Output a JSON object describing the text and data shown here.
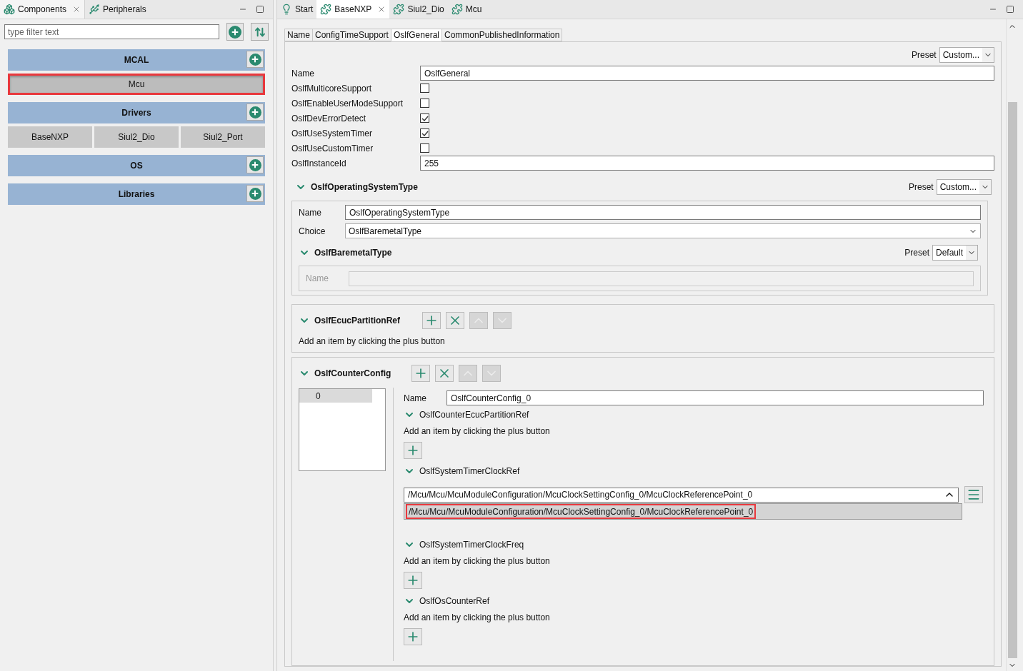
{
  "left_panel": {
    "tabs": [
      {
        "label": "Components",
        "kind": "components",
        "selected": true,
        "closable": true
      },
      {
        "label": "Peripherals",
        "kind": "peripherals",
        "selected": false,
        "closable": false
      }
    ],
    "filter": {
      "placeholder": "type filter text"
    },
    "categories": [
      {
        "name": "MCAL",
        "items": [
          {
            "label": "Mcu",
            "selected": true,
            "highlighted": true
          }
        ]
      },
      {
        "name": "Drivers",
        "items": [
          {
            "label": "BaseNXP",
            "selected": false,
            "highlighted": false
          },
          {
            "label": "Siul2_Dio",
            "selected": false,
            "highlighted": false
          },
          {
            "label": "Siul2_Port",
            "selected": false,
            "highlighted": false
          }
        ]
      },
      {
        "name": "OS"
      },
      {
        "name": "Libraries"
      }
    ]
  },
  "editor": {
    "tabs": [
      {
        "label": "Start",
        "kind": "start",
        "selected": false,
        "closable": false
      },
      {
        "label": "BaseNXP",
        "kind": "module",
        "selected": true,
        "closable": true
      },
      {
        "label": "Siul2_Dio",
        "kind": "module",
        "selected": false,
        "closable": false
      },
      {
        "label": "Mcu",
        "kind": "module",
        "selected": false,
        "closable": false
      }
    ],
    "subtabs": [
      {
        "label": "Name",
        "selected": false
      },
      {
        "label": "ConfigTimeSupport",
        "selected": false
      },
      {
        "label": "OslfGeneral",
        "selected": true
      },
      {
        "label": "CommonPublishedInformation",
        "selected": false
      }
    ],
    "preset_label": "Preset",
    "preset": "Custom...",
    "fields": [
      {
        "kind": "text",
        "label": "Name",
        "value": "OslfGeneral"
      },
      {
        "kind": "checkbox",
        "label": "OslfMulticoreSupport",
        "checked": false
      },
      {
        "kind": "checkbox",
        "label": "OslfEnableUserModeSupport",
        "checked": false
      },
      {
        "kind": "checkbox",
        "label": "OslfDevErrorDetect",
        "checked": true
      },
      {
        "kind": "checkbox",
        "label": "OslfUseSystemTimer",
        "checked": true
      },
      {
        "kind": "checkbox",
        "label": "OslfUseCustomTimer",
        "checked": false
      },
      {
        "kind": "text",
        "label": "OslfInstanceId",
        "value": "255"
      }
    ],
    "os_type": {
      "title": "OslfOperatingSystemType",
      "expanded": true,
      "preset_label": "Preset",
      "preset": "Custom...",
      "name_label": "Name",
      "name": "OslfOperatingSystemType",
      "choice_label": "Choice",
      "choice": "OslfBaremetalType",
      "baremetal": {
        "title": "OslfBaremetalType",
        "expanded": true,
        "preset_label": "Preset",
        "preset": "Default",
        "field_label": "Name",
        "disabled": true
      }
    },
    "ecuc_partition_ref": {
      "title": "OslfEcucPartitionRef",
      "expanded": true,
      "hint": "Add an item by clicking the plus button"
    },
    "counter_config": {
      "title": "OslfCounterConfig",
      "expanded": true,
      "items": [
        {
          "label": "0",
          "selected": true
        }
      ],
      "name_label": "Name",
      "name": "OslfCounterConfig_0",
      "subsections": [
        {
          "kind": "list",
          "title": "OslfCounterEcucPartitionRef",
          "expanded": true,
          "hint": "Add an item by clicking the plus button"
        },
        {
          "kind": "reference",
          "title": "OslfSystemTimerClockRef",
          "expanded": true,
          "value": "/Mcu/Mcu/McuModuleConfiguration/McuClockSettingConfig_0/McuClockReferencePoint_0",
          "suggestions": [
            {
              "label": "/Mcu/Mcu/McuModuleConfiguration/McuClockSettingConfig_0/McuClockReferencePoint_0",
              "selected": true,
              "highlighted": true
            }
          ]
        },
        {
          "kind": "list",
          "title": "OslfSystemTimerClockFreq",
          "expanded": true,
          "hint": "Add an item by clicking the plus button"
        },
        {
          "kind": "list",
          "title": "OslfOsCounterRef",
          "expanded": true,
          "hint": "Add an item by clicking the plus button"
        }
      ]
    }
  }
}
